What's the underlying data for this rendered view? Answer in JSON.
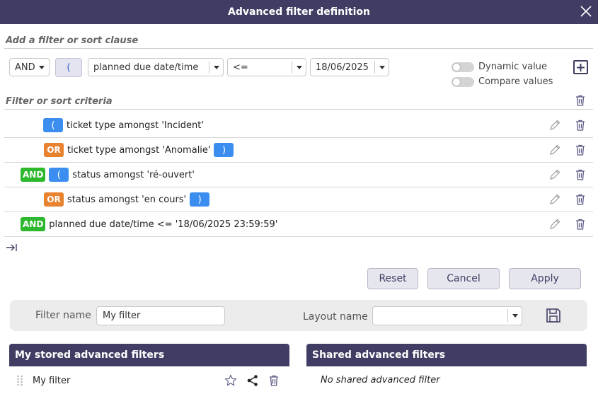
{
  "dialog": {
    "title": "Advanced filter definition"
  },
  "add_clause": {
    "section_title": "Add a filter or sort clause",
    "logic_value": "AND",
    "open_paren_label": "(",
    "field_value": "planned due date/time",
    "operator_value": "<=",
    "date_value": "18/06/2025",
    "dynamic_value_label": "Dynamic value",
    "compare_values_label": "Compare values",
    "dynamic_value_on": false,
    "compare_values_on": false
  },
  "criteria": {
    "section_title": "Filter or sort criteria",
    "rows": [
      {
        "logic": "",
        "open_paren": "(",
        "text": "ticket type amongst 'Incident'",
        "close_paren": ""
      },
      {
        "logic": "OR",
        "open_paren": "",
        "text": "ticket type amongst 'Anomalie'",
        "close_paren": ")"
      },
      {
        "logic": "AND",
        "open_paren": "(",
        "text": "status amongst 'ré-ouvert'",
        "close_paren": ""
      },
      {
        "logic": "OR",
        "open_paren": "",
        "text": "status amongst 'en cours'",
        "close_paren": ")"
      },
      {
        "logic": "AND",
        "open_paren": "",
        "text": "planned due date/time <= '18/06/2025 23:59:59'",
        "close_paren": ""
      }
    ]
  },
  "actions": {
    "reset_label": "Reset",
    "cancel_label": "Cancel",
    "apply_label": "Apply"
  },
  "naming": {
    "filter_name_label": "Filter name",
    "filter_name_value": "My filter",
    "layout_name_label": "Layout name",
    "layout_name_value": ""
  },
  "stored_filters": {
    "title": "My stored advanced filters",
    "items": [
      {
        "name": "My filter"
      }
    ]
  },
  "shared_filters": {
    "title": "Shared advanced filters",
    "empty_text": "No shared advanced filter"
  },
  "colors": {
    "header_bg": "#3f3d63",
    "and_badge": "#2eb82e",
    "or_badge": "#e8822f",
    "paren_badge": "#3b8ef0"
  }
}
